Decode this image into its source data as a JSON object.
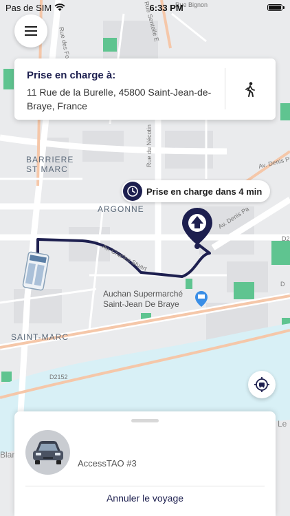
{
  "status_bar": {
    "carrier": "Pas de SIM",
    "time": "6:33 PM"
  },
  "pickup": {
    "title": "Prise en charge à:",
    "address": "11 Rue de la Burelle, 45800 Saint-Jean-de-Braye, France"
  },
  "eta": {
    "text": "Prise en charge dans 4 min"
  },
  "map": {
    "places": {
      "barriere": "BARRIERE",
      "st_marc": "ST MARC",
      "argonne": "ARGONNE",
      "saint_marc": "SAINT-MARC",
      "auchan_line1": "Auchan Supermarché",
      "auchan_line2": "Saint-Jean De Braye",
      "d2152": "D2152",
      "d2_partial": "D2",
      "d9_partial": "D",
      "av_denis": "Av. Denis Pa",
      "rue_necotin": "Rue du Nécotin",
      "rue_ste_e": "Rue Sentelle E",
      "rue_fosses": "Rue des Fosses",
      "blan": "Blan",
      "le": "Le",
      "rue_bignon": "Rue Bignon",
      "av_denis_small": "Av. Denis Pa",
      "av_stuart": "Av. Charles Stuart"
    },
    "colors": {
      "route": "#1d1f4f",
      "water": "#d8f0f6",
      "park": "#5fc490",
      "road_major": "#f5c7a9"
    }
  },
  "bottom_sheet": {
    "vehicle_name": "AccessTAO #3",
    "cancel_label": "Annuler le voyage"
  }
}
